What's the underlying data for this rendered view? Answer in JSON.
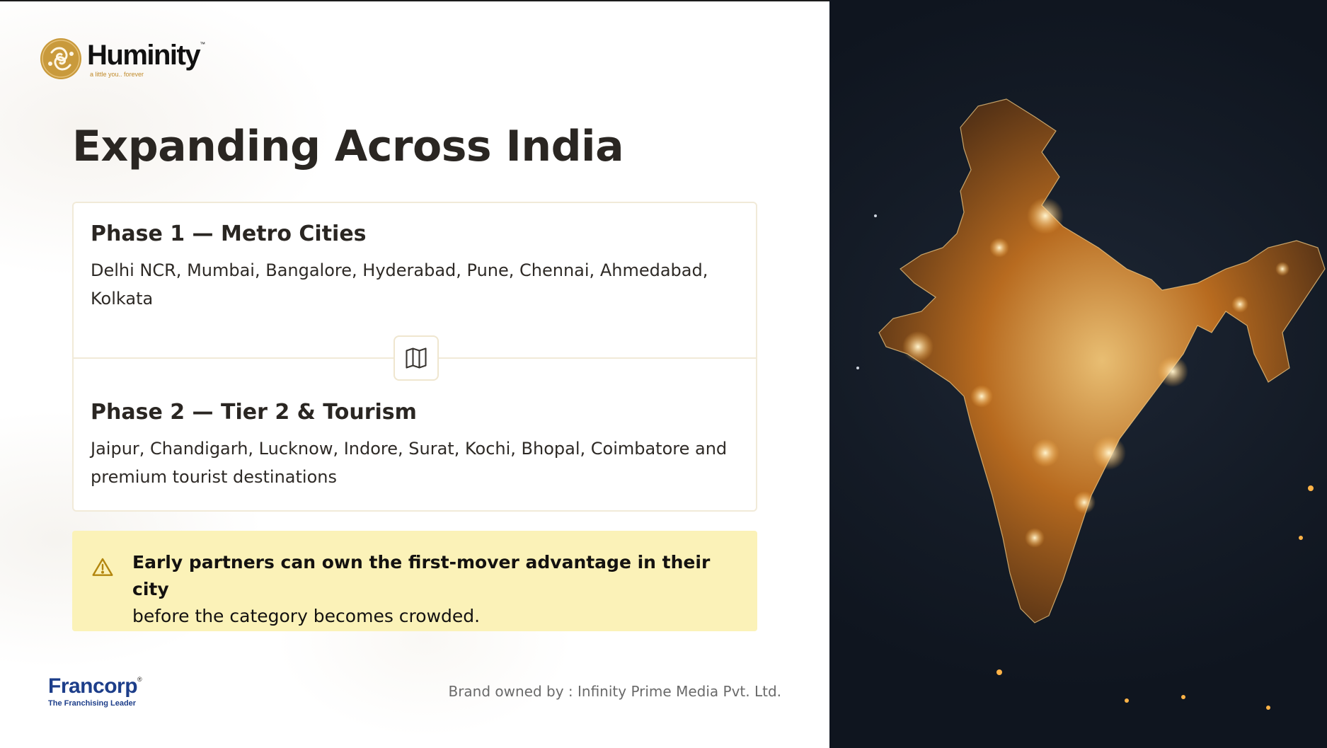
{
  "brand": {
    "name": "Huminity",
    "tm": "™",
    "tagline": "a little you.. forever",
    "accent_color": "#c08a2a"
  },
  "title": "Expanding Across India",
  "phases": [
    {
      "title": "Phase 1 — Metro Cities",
      "text": "Delhi NCR, Mumbai, Bangalore, Hyderabad, Pune, Chennai, Ahmedabad, Kolkata"
    },
    {
      "title": "Phase 2 — Tier 2 & Tourism",
      "text": "Jaipur, Chandigarh, Lucknow, Indore, Surat, Kochi, Bhopal, Coimbatore and premium tourist destinations"
    }
  ],
  "divider_icon": "map-icon",
  "notice": {
    "icon": "warning-icon",
    "strong": "Early partners can own the first-mover advantage in their city",
    "rest": "before the category becomes crowded.",
    "background_color": "#fbf2b8"
  },
  "partner": {
    "name": "Francorp",
    "reg": "®",
    "tagline": "The Franchising Leader",
    "color": "#1d3e8a"
  },
  "footer": {
    "credit": "Brand owned by : Infinity Prime Media Pvt. Ltd."
  },
  "image": {
    "subject": "india-night-lights-map"
  }
}
